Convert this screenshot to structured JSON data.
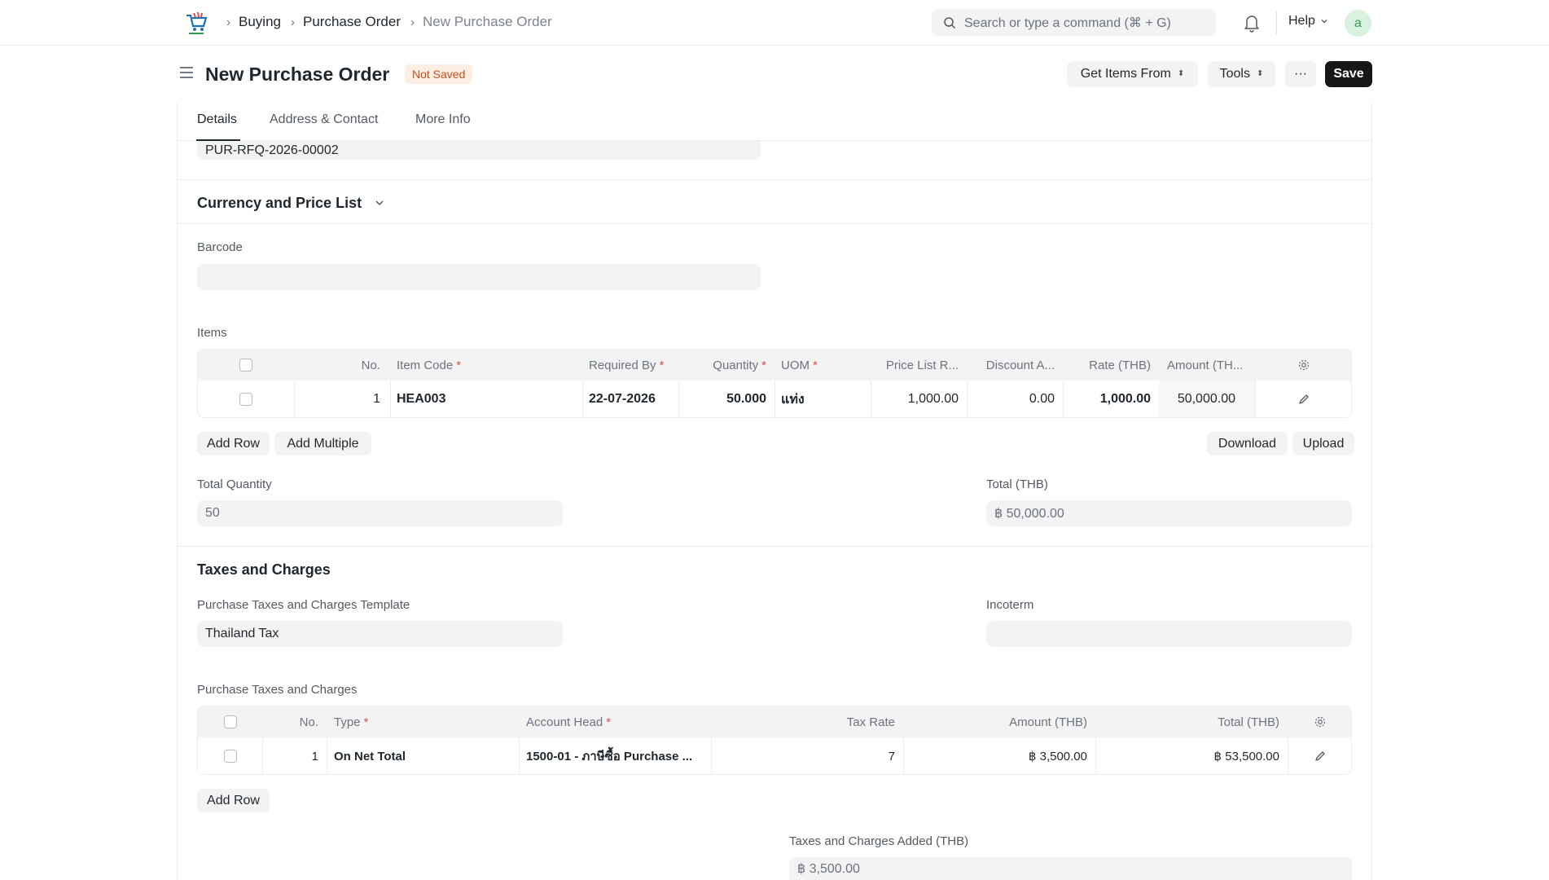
{
  "navbar": {
    "breadcrumbs": [
      "Buying",
      "Purchase Order",
      "New Purchase Order"
    ],
    "search_placeholder": "Search or type a command (⌘ + G)",
    "help_label": "Help",
    "avatar_initial": "a"
  },
  "page_head": {
    "title": "New Purchase Order",
    "status_badge": "Not Saved",
    "get_items_label": "Get Items From",
    "tools_label": "Tools",
    "more_label": "···",
    "save_label": "Save"
  },
  "tabs": [
    "Details",
    "Address & Contact",
    "More Info"
  ],
  "rfq_value": "PUR-RFQ-2026-00002",
  "currency_section_title": "Currency and Price List",
  "barcode": {
    "label": "Barcode",
    "value": ""
  },
  "items": {
    "label": "Items",
    "headers": [
      "No.",
      "Item Code",
      "Required By",
      "Quantity",
      "UOM",
      "Price List R...",
      "Discount A...",
      "Rate (THB)",
      "Amount (TH..."
    ],
    "rows": [
      {
        "no": "1",
        "item_code": "HEA003",
        "required_by": "22-07-2026",
        "quantity": "50.000",
        "uom": "แท่ง",
        "price_list_rate": "1,000.00",
        "discount": "0.00",
        "rate": "1,000.00",
        "amount": "50,000.00"
      }
    ],
    "add_row_label": "Add Row",
    "add_multiple_label": "Add Multiple",
    "download_label": "Download",
    "upload_label": "Upload"
  },
  "total_quantity": {
    "label": "Total Quantity",
    "value": "50"
  },
  "total": {
    "label": "Total (THB)",
    "value": "฿ 50,000.00"
  },
  "taxes_section_title": "Taxes and Charges",
  "tax_template": {
    "label": "Purchase Taxes and Charges Template",
    "value": "Thailand Tax"
  },
  "incoterm": {
    "label": "Incoterm",
    "value": ""
  },
  "taxes": {
    "label": "Purchase Taxes and Charges",
    "headers": [
      "No.",
      "Type",
      "Account Head",
      "Tax Rate",
      "Amount (THB)",
      "Total (THB)"
    ],
    "rows": [
      {
        "no": "1",
        "type": "On Net Total",
        "account_head": "1500-01 - ภาษีซื้อ Purchase ...",
        "tax_rate": "7",
        "amount": "฿ 3,500.00",
        "total": "฿ 53,500.00"
      }
    ],
    "add_row_label": "Add Row"
  },
  "taxes_added": {
    "label": "Taxes and Charges Added (THB)",
    "value": "฿ 3,500.00"
  },
  "colors": {
    "accent": "#171717",
    "badge_bg": "#fdeee4",
    "badge_text": "#c4501f",
    "required": "#e24c4c"
  }
}
